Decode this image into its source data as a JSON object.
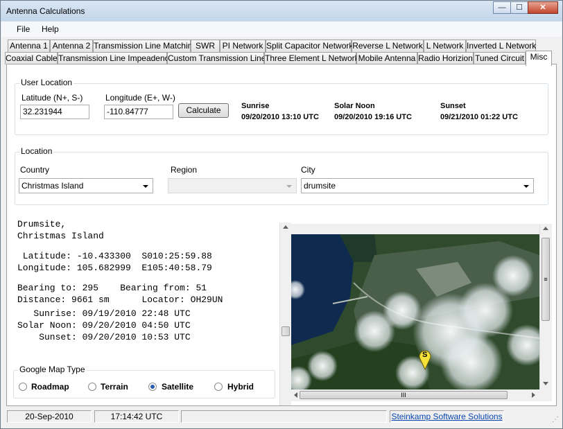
{
  "window": {
    "title": "Antenna Calculations",
    "minimize": "—",
    "maximize": "☐",
    "close": "✕"
  },
  "menu": {
    "file": "File",
    "help": "Help"
  },
  "tabs_row1": [
    "Antenna 1",
    "Antenna 2",
    "Transmission Line Matching",
    "SWR",
    "PI Network",
    "Split Capacitor Network",
    "Reverse L Network",
    "L Network",
    "Inverted L Network"
  ],
  "tabs_row2": [
    "Coaxial Cable",
    "Transmission Line Impeadence",
    "Custom Transmission Lines",
    "Three Element L Network",
    "Mobile Antenna",
    "Radio Horizion",
    "Tuned Circuit",
    "Misc"
  ],
  "user_location": {
    "title": "User Location",
    "lat_label": "Latitude (N+, S-)",
    "lat_value": "32.231944",
    "lon_label": "Longitude (E+, W-)",
    "lon_value": "-110.84777",
    "calculate": "Calculate",
    "sunrise_label": "Sunrise",
    "sunrise_value": "09/20/2010 13:10 UTC",
    "noon_label": "Solar Noon",
    "noon_value": "09/20/2010 19:16 UTC",
    "sunset_label": "Sunset",
    "sunset_value": "09/21/2010 01:22 UTC"
  },
  "location": {
    "title": "Location",
    "country_label": "Country",
    "country_value": "Christmas Island",
    "region_label": "Region",
    "region_value": "",
    "city_label": "City",
    "city_value": "drumsite"
  },
  "details": {
    "line1": "Drumsite,",
    "line2": "Christmas Island",
    "line3": " Latitude: -10.433300  S010:25:59.88",
    "line4": "Longitude: 105.682999  E105:40:58.79",
    "line5": "Bearing to: 295    Bearing from: 51",
    "line6": "Distance: 9661 sm      Locator: OH29UN",
    "line7": "   Sunrise: 09/19/2010 22:48 UTC",
    "line8": "Solar Noon: 09/20/2010 04:50 UTC",
    "line9": "    Sunset: 09/20/2010 10:53 UTC"
  },
  "map_type": {
    "title": "Google Map Type",
    "options": [
      "Roadmap",
      "Terrain",
      "Satellite",
      "Hybrid"
    ],
    "selected": "Satellite"
  },
  "map": {
    "marker_label": "S",
    "hscroll_grip": "III",
    "vscroll_grip": "≡"
  },
  "status": {
    "date": "20-Sep-2010",
    "time": "17:14:42 UTC",
    "message": "",
    "link": "Steinkamp Software Solutions"
  }
}
